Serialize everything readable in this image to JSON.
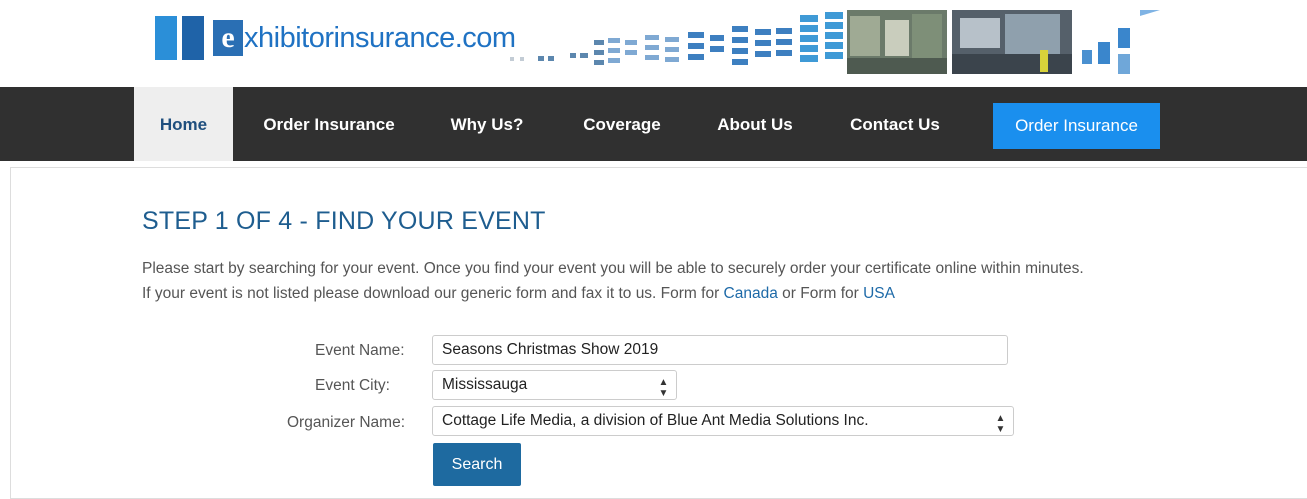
{
  "brand": {
    "logo_letter": "e",
    "logo_text": "xhibitorinsurance.com"
  },
  "nav": {
    "items": [
      {
        "label": "Home"
      },
      {
        "label": "Order Insurance"
      },
      {
        "label": "Why Us?"
      },
      {
        "label": "Coverage"
      },
      {
        "label": "About Us"
      },
      {
        "label": "Contact Us"
      }
    ],
    "cta_label": "Order Insurance"
  },
  "page": {
    "title": "STEP 1 OF 4 - FIND YOUR EVENT",
    "intro_line1": "Please start by searching for your event. Once you find your event you will be able to securely order your certificate online within minutes.",
    "intro_line2_prefix": "If your event is not listed please download our generic form and fax it to us. Form for ",
    "canada_link": "Canada",
    "intro_line2_middle": " or Form for ",
    "usa_link": "USA"
  },
  "form": {
    "event_name_label": "Event Name:",
    "event_name_value": "Seasons Christmas Show 2019",
    "event_city_label": "Event City:",
    "event_city_value": "Mississauga",
    "organizer_label": "Organizer Name:",
    "organizer_value": "Cottage Life Media, a division of Blue Ant Media Solutions Inc.",
    "select_arrows": "▲▼",
    "search_label": "Search"
  },
  "colors": {
    "nav_bg": "#303030",
    "accent": "#1a8fee",
    "heading": "#1e5d8f",
    "button": "#1e6aa0"
  }
}
